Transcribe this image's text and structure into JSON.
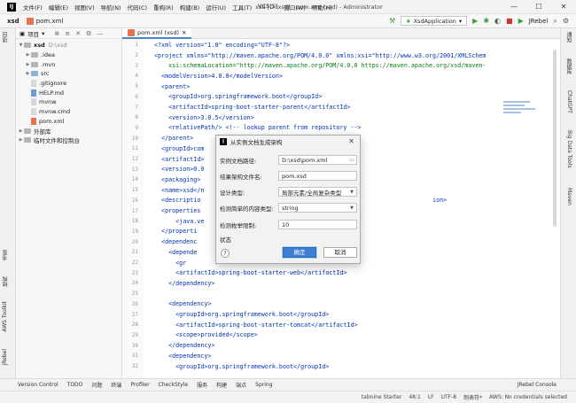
{
  "menu": [
    "文件(F)",
    "编辑(E)",
    "视图(V)",
    "导航(N)",
    "代码(C)",
    "重构(R)",
    "构建(B)",
    "运行(U)",
    "工具(T)",
    "VCS(S)",
    "窗口(W)",
    "帮助(H)"
  ],
  "window_title": "xsd [D:\\xsd] - pom.xml (xsd) - Administrator",
  "window_controls": {
    "minimize": "—",
    "maximize": "☐",
    "close": "✕"
  },
  "breadcrumb": {
    "project": "xsd",
    "file": "pom.xml"
  },
  "toolbar": {
    "run_config": "XsdApplication",
    "jrebel": "JRebel"
  },
  "project_panel": {
    "title": "项目",
    "items": [
      {
        "label": "xsd",
        "hint": "D:\\xsd",
        "type": "root"
      },
      {
        "label": ".idea",
        "type": "folder"
      },
      {
        "label": ".mvn",
        "type": "folder"
      },
      {
        "label": "src",
        "type": "folder"
      },
      {
        "label": ".gitignore",
        "type": "file"
      },
      {
        "label": "HELP.md",
        "type": "md"
      },
      {
        "label": "mvnw",
        "type": "file"
      },
      {
        "label": "mvnw.cmd",
        "type": "file"
      },
      {
        "label": "pom.xml",
        "type": "maven"
      },
      {
        "label": "外部库",
        "type": "lib"
      },
      {
        "label": "临时文件和控制台",
        "type": "scratch"
      }
    ]
  },
  "editor": {
    "tab_label": "pom.xml (xsd)",
    "lines": [
      {
        "n": "1",
        "code": "<?xml version=\"1.0\" encoding=\"UTF-8\"?>"
      },
      {
        "n": "2",
        "code": "<project xmlns=\"http://maven.apache.org/POM/4.0.0\" xmlns:xsi=\"http://www.w3.org/2001/XMLSchem"
      },
      {
        "n": "3",
        "code": "    xsi:schemaLocation=\"http://maven.apache.org/POM/4.0.0 https://maven.apache.org/xsd/maven-"
      },
      {
        "n": "4",
        "code": "  <modelVersion>4.0.0</modelVersion>"
      },
      {
        "n": "5",
        "code": "  <parent>"
      },
      {
        "n": "6",
        "code": "    <groupId>org.springframework.boot</groupId>"
      },
      {
        "n": "7",
        "code": "    <artifactId>spring-boot-starter-parent</artifactId>"
      },
      {
        "n": "8",
        "code": "    <version>3.0.5</version>"
      },
      {
        "n": "9",
        "code": "    <relativePath/> <!-- lookup parent from repository -->"
      },
      {
        "n": "10",
        "code": "  </parent>"
      },
      {
        "n": "11",
        "code": "  <groupId>com"
      },
      {
        "n": "12",
        "code": "  <artifactId>"
      },
      {
        "n": "13",
        "code": "  <version>0.0"
      },
      {
        "n": "14",
        "code": "  <packaging>"
      },
      {
        "n": "15",
        "code": "  <name>xsd</n"
      },
      {
        "n": "16",
        "code": "  <descriptio                                                                 ion>"
      },
      {
        "n": "17",
        "code": "  <properties"
      },
      {
        "n": "18",
        "code": "      <java.ve"
      },
      {
        "n": "19",
        "code": "  </properti"
      },
      {
        "n": "20",
        "code": "  <dependenc"
      },
      {
        "n": "21",
        "code": "    <depende"
      },
      {
        "n": "22",
        "code": "      <gr"
      },
      {
        "n": "23",
        "code": "      <artifactId>spring-boot-starter-web</artifactId>"
      },
      {
        "n": "24",
        "code": "    </dependency>"
      },
      {
        "n": "25",
        "code": ""
      },
      {
        "n": "26",
        "code": "    <dependency>"
      },
      {
        "n": "27",
        "code": "      <groupId>org.springframework.boot</groupId>"
      },
      {
        "n": "28",
        "code": "      <artifactId>spring-boot-starter-tomcat</artifactId>"
      },
      {
        "n": "29",
        "code": "      <scope>provided</scope>"
      },
      {
        "n": "30",
        "code": "    </dependency>"
      },
      {
        "n": "31",
        "code": "    <dependency>"
      },
      {
        "n": "32",
        "code": "      <groupId>org.springframework.boot</groupId>"
      }
    ]
  },
  "dialog": {
    "title": "从实例文档生成架构",
    "fields": [
      {
        "label": "实例文档路径:",
        "value": "D:\\xsd\\pom.xml",
        "kind": "path"
      },
      {
        "label": "结果架构文件名:",
        "value": "pom.xsd",
        "kind": "text"
      },
      {
        "label": "设计类型:",
        "value": "局部元素/全局复杂类型",
        "kind": "select"
      },
      {
        "label": "检测简单的内容类型:",
        "value": "string",
        "kind": "select"
      },
      {
        "label": "检测枚举限制:",
        "value": "10",
        "kind": "text"
      }
    ],
    "status_label": "状态",
    "ok": "确定",
    "cancel": "取消"
  },
  "left_stripe": [
    "项目",
    "书签",
    "结构",
    "AWS Toolkit",
    "JRebel"
  ],
  "right_stripe": [
    "通知",
    "数据库",
    "ChatGPT",
    "Big Data Tools",
    "Maven"
  ],
  "bottom_tools": [
    "Version Control",
    "TODO",
    "问题",
    "终端",
    "Profiler",
    "CheckStyle",
    "服务",
    "构建",
    "端点",
    "Spring",
    "JRebel Console"
  ],
  "status": [
    "tabnine Starter",
    "48:1",
    "LF",
    "UTF-8",
    "制表符*",
    "AWS: No credentials selected"
  ]
}
